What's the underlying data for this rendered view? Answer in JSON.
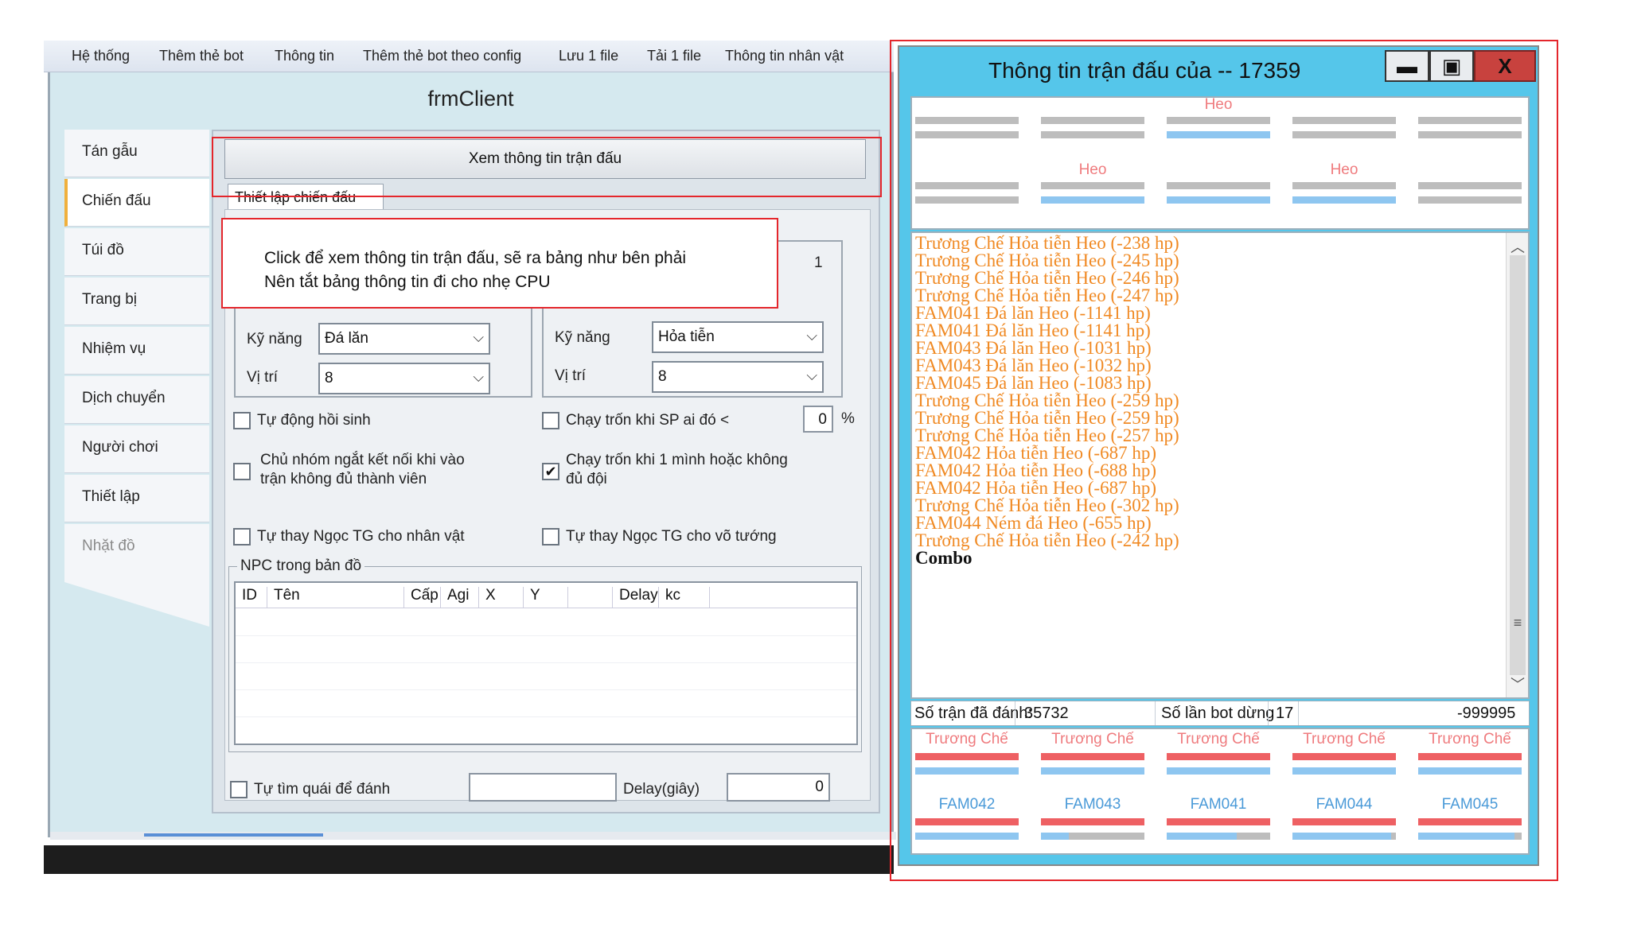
{
  "menu": [
    "Hệ thống",
    "Thêm thẻ bot",
    "Thông tin",
    "Thêm thẻ bot theo config",
    "Lưu 1 file",
    "Tải 1 file",
    "Thông tin nhân vật"
  ],
  "left_window": {
    "title": "frmClient",
    "side_tabs": [
      "Tán gẫu",
      "Chiến đấu",
      "Túi đồ",
      "Trang bị",
      "Nhiệm vụ",
      "Dịch chuyển",
      "Người chơi",
      "Thiết lập",
      "Nhặt đồ"
    ],
    "view_button": "Xem thông tin trận đấu",
    "sub_tab": "Thiết lập chiến đấu",
    "group1": {
      "skill_label": "Kỹ năng",
      "skill_value": "Đá lăn",
      "pos_label": "Vị trí",
      "pos_value": "8"
    },
    "group2": {
      "count": "1",
      "skill_label": "Kỹ năng",
      "skill_value": "Hỏa tiễn",
      "pos_label": "Vị trí",
      "pos_value": "8"
    },
    "auto_revive": "Tự động hồi sinh",
    "flee_sp": "Chạy trốn khi SP ai đó <",
    "flee_sp_value": "0",
    "percent": "%",
    "leader_disconnect_1": "Chủ nhóm ngắt kết nối khi vào",
    "leader_disconnect_2": "trận không đủ thành viên",
    "flee_alone_1": "Chạy trốn khi 1 mình hoặc không",
    "flee_alone_2": "đủ đội",
    "replace_gem_char": "Tự thay Ngọc TG cho nhân vật",
    "replace_gem_general": "Tự thay Ngọc TG cho võ tướng",
    "npc_group": "NPC trong bản đồ",
    "npc_columns": [
      "ID",
      "Tên",
      "Cấp",
      "Agi",
      "X",
      "Y",
      "Delay",
      "kc"
    ],
    "auto_find": "Tự tìm quái để đánh",
    "delay_label": "Delay(giây)",
    "delay_value": "0"
  },
  "callout": {
    "line1": "Click để xem thông tin trận đấu, sẽ ra bảng như bên phải",
    "line2": "Nên tắt bảng thông tin đi cho nhẹ CPU"
  },
  "right_window": {
    "title": "Thông tin trận đấu của -- 17359",
    "buttons": {
      "minimize": "▬",
      "maximize": "▣",
      "close": "X"
    },
    "enemy_slots": [
      {
        "name": "Heo",
        "hp": 0.0,
        "mp": 1.0
      },
      {
        "name": "Heo",
        "hp": 0.0,
        "mp": 1.0
      },
      {
        "name": "Heo",
        "hp": 0.0,
        "mp": 1.0
      }
    ],
    "log": [
      "Trương Chế Hỏa tiễn Heo (-238 hp)",
      "Trương Chế Hỏa tiễn Heo (-245 hp)",
      "Trương Chế Hỏa tiễn Heo (-246 hp)",
      "Trương Chế Hỏa tiễn Heo (-247 hp)",
      "FAM041 Đá lăn Heo (-1141 hp)",
      "FAM041 Đá lăn Heo (-1141 hp)",
      "FAM043 Đá lăn Heo (-1031 hp)",
      "FAM043 Đá lăn Heo (-1032 hp)",
      "FAM045 Đá lăn Heo (-1083 hp)",
      "Trương Chế Hỏa tiễn Heo (-259 hp)",
      "Trương Chế Hỏa tiễn Heo (-259 hp)",
      "Trương Chế Hỏa tiễn Heo (-257 hp)",
      "FAM042 Hỏa tiễn Heo (-687 hp)",
      "FAM042 Hỏa tiễn Heo (-688 hp)",
      "FAM042 Hỏa tiễn Heo (-687 hp)",
      "Trương Chế Hỏa tiễn Heo (-302 hp)",
      "FAM044 Ném đá Heo (-655 hp)",
      "Trương Chế Hỏa tiễn Heo (-242 hp)",
      "Combo"
    ],
    "stats": {
      "battles_label": "Số trận đã đánh:",
      "battles_value": "35732",
      "stops_label": "Số lần bot dừng",
      "stops_value": "17",
      "extra_value": "-999995"
    },
    "ally_top": [
      "Trương Chế",
      "Trương Chế",
      "Trương Chế",
      "Trương Chế",
      "Trương Chế"
    ],
    "ally_bottom": [
      {
        "name": "FAM042",
        "mp": 1.0
      },
      {
        "name": "FAM043",
        "mp": 0.27
      },
      {
        "name": "FAM041",
        "mp": 0.68
      },
      {
        "name": "FAM044",
        "mp": 0.95
      },
      {
        "name": "FAM045",
        "mp": 0.93
      }
    ],
    "colors": {
      "log_text": "#f08a24",
      "hp_bar": "#ee6063",
      "mp_bar": "#8ec6f0",
      "empty_bar": "#bdbdbd",
      "window_bg": "#55c6ea"
    }
  }
}
